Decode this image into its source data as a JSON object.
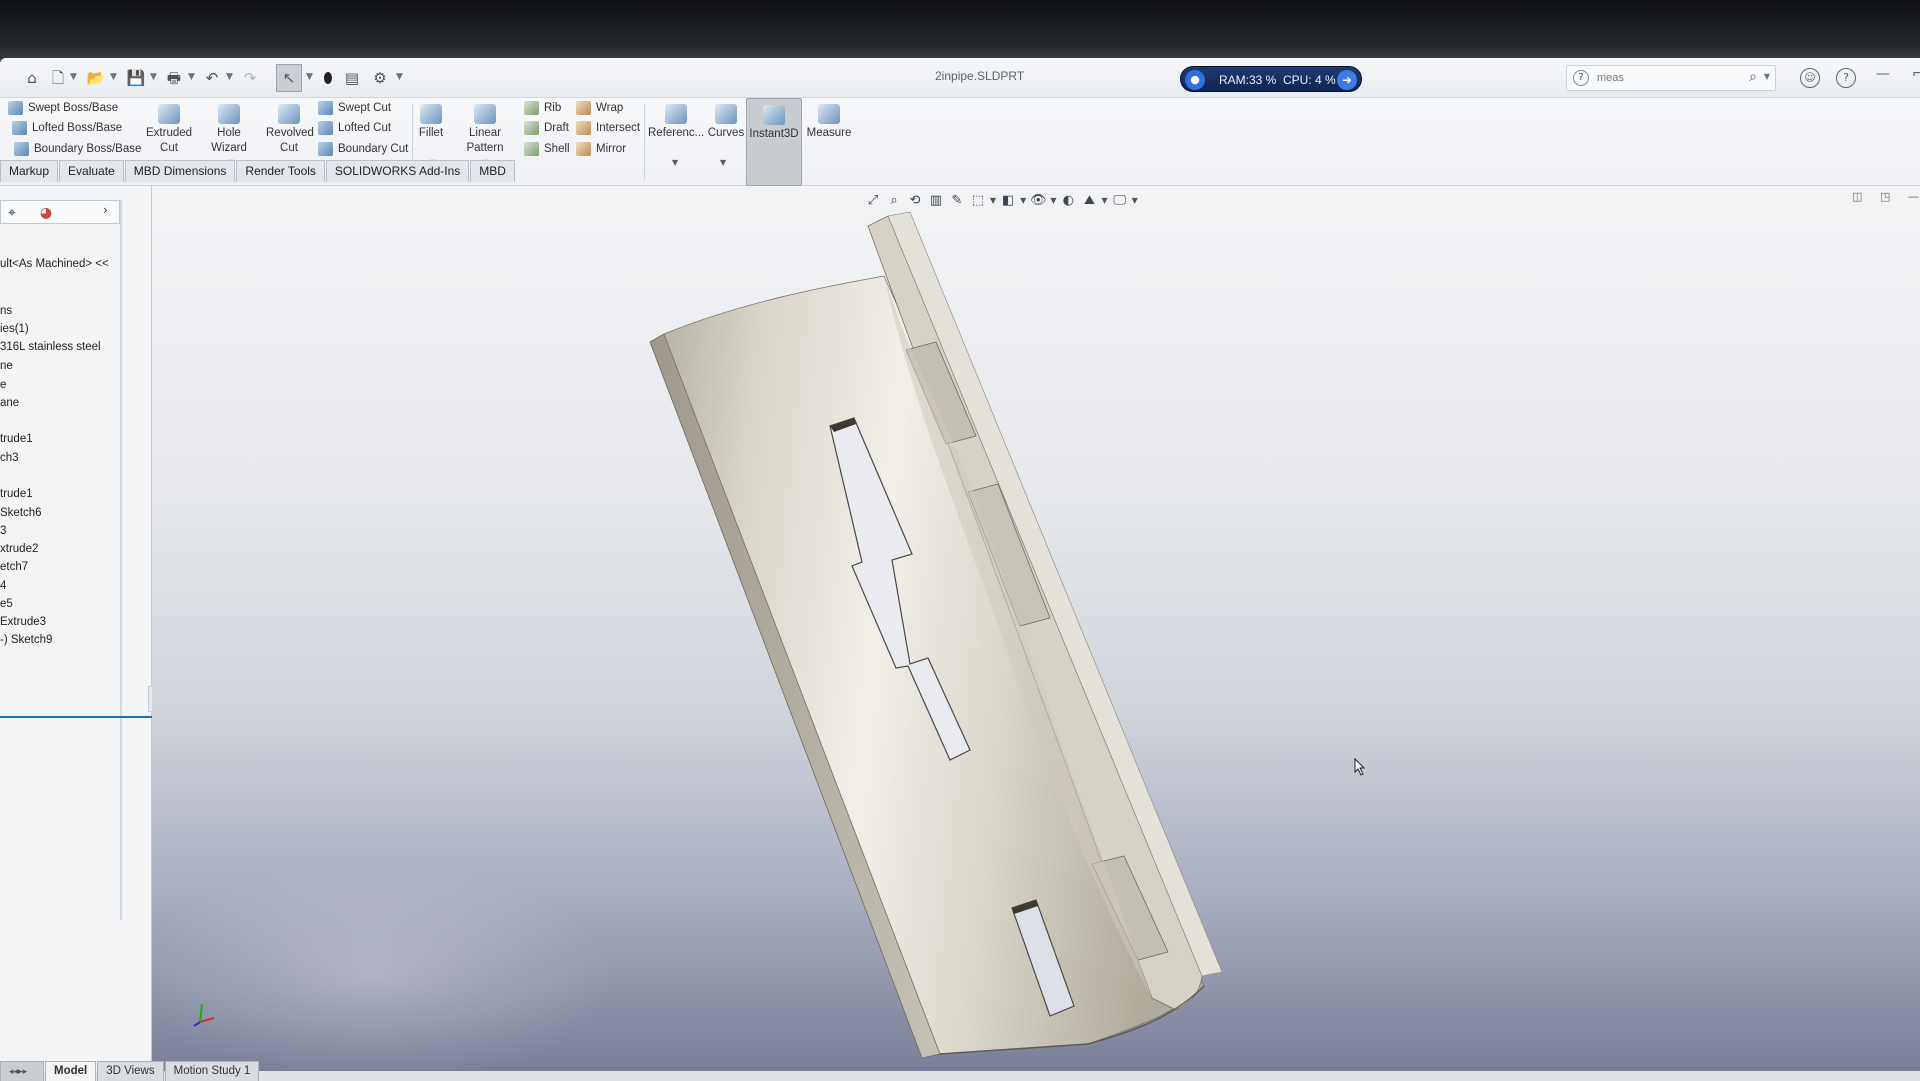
{
  "quick_access": {
    "icons": [
      "home-icon",
      "new-document-icon",
      "open-icon",
      "save-icon",
      "print-icon",
      "undo-icon",
      "redo-icon",
      "select-icon",
      "rebuild-icon",
      "file-properties-icon",
      "options-icon"
    ]
  },
  "title": "2inpipe.SLDPRT",
  "performance": {
    "ram": "RAM:33 %",
    "cpu": "CPU: 4 %"
  },
  "search": {
    "placeholder": "meas",
    "help": "?"
  },
  "ribbon": {
    "swept_boss": "Swept Boss/Base",
    "lofted_boss": "Lofted Boss/Base",
    "boundary_boss": "Boundary Boss/Base",
    "extruded_cut": [
      "Extruded",
      "Cut"
    ],
    "hole_wizard": "Hole Wizard",
    "revolved_cut": [
      "Revolved",
      "Cut"
    ],
    "swept_cut": "Swept Cut",
    "lofted_cut": "Lofted Cut",
    "boundary_cut": "Boundary Cut",
    "fillet": "Fillet",
    "linear_pattern": "Linear Pattern",
    "rib": "Rib",
    "draft": "Draft",
    "shell": "Shell",
    "wrap": "Wrap",
    "intersect": "Intersect",
    "mirror": "Mirror",
    "reference": "Referenc...",
    "curves": "Curves",
    "instant3d": "Instant3D",
    "measure": "Measure"
  },
  "tabs": [
    "Markup",
    "Evaluate",
    "MBD Dimensions",
    "Render Tools",
    "SOLIDWORKS Add-Ins",
    "MBD"
  ],
  "tree": {
    "root": "ult<As Machined> <<",
    "items": [
      "ns",
      "ies(1)",
      "316L stainless steel",
      "ne",
      "e",
      "ane",
      "trude1",
      "ch3",
      "trude1",
      "Sketch6",
      "3",
      "xtrude2",
      "etch7",
      "4",
      "e5",
      "Extrude3",
      "-) Sketch9"
    ]
  },
  "bottom_tabs": [
    "Model",
    "3D Views",
    "Motion Study 1"
  ]
}
